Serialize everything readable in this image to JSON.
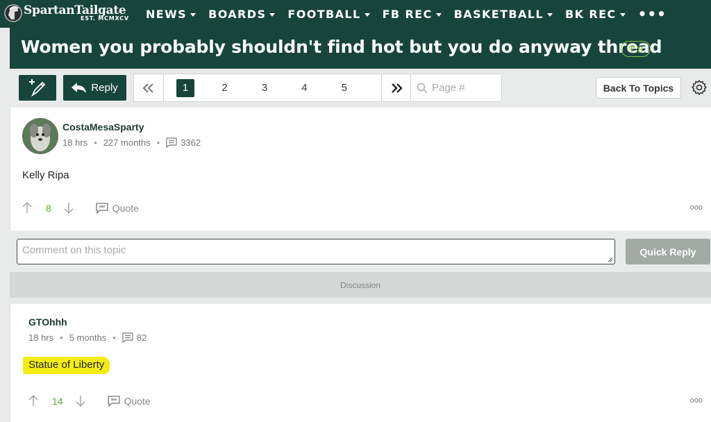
{
  "site": {
    "name": "SpartanTailgate",
    "tagline": "EST. MCMXCV"
  },
  "nav": {
    "items": [
      {
        "label": "NEWS"
      },
      {
        "label": "BOARDS"
      },
      {
        "label": "FOOTBALL"
      },
      {
        "label": "FB REC"
      },
      {
        "label": "BASKETBALL"
      },
      {
        "label": "BK REC"
      }
    ],
    "more": "•••"
  },
  "thread": {
    "title": "Women you probably shouldn't find hot but you do anyway thread",
    "votes": "8"
  },
  "toolbar": {
    "reply_label": "Reply",
    "pages": [
      "1",
      "2",
      "3",
      "4",
      "5"
    ],
    "current_page": "1",
    "page_placeholder": "Page #",
    "back_label": "Back To Topics"
  },
  "posts": [
    {
      "username": "CostaMesaSparty",
      "time": "18 hrs",
      "tenure": "227 months",
      "post_count": "3362",
      "body": "Kelly Ripa",
      "score": "8",
      "quote_label": "Quote",
      "more": "ooo"
    },
    {
      "username": "GTOhhh",
      "time": "18 hrs",
      "tenure": "5 months",
      "post_count": "82",
      "body": "Statue of Liberty",
      "score": "14",
      "quote_label": "Quote",
      "more": "ooo"
    }
  ],
  "comment": {
    "placeholder": "Comment on this topic",
    "submit_label": "Quick Reply"
  },
  "discussion_label": "Discussion",
  "colors": {
    "brand_green": "#18453b",
    "vote_green": "#5da83a",
    "highlight": "#f5ec15"
  }
}
